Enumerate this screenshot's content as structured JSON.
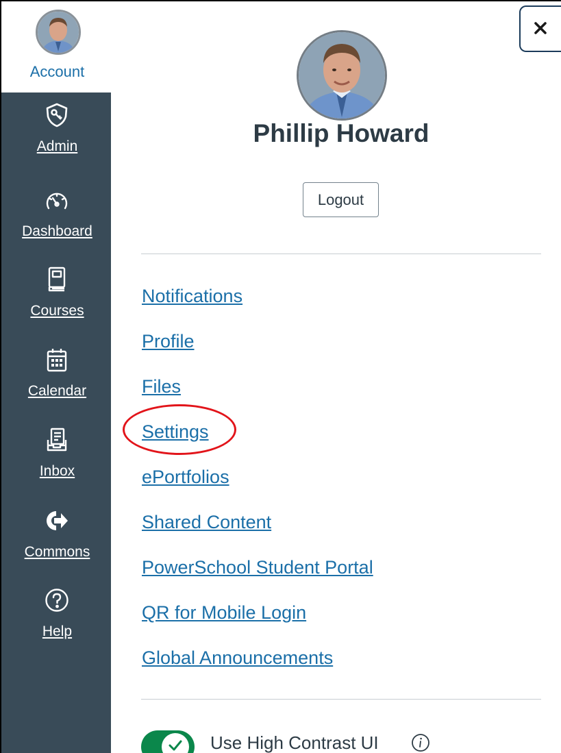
{
  "nav": {
    "account": {
      "label": "Account",
      "icon": "user-avatar"
    },
    "items": [
      {
        "label": "Admin",
        "icon": "shield-icon"
      },
      {
        "label": "Dashboard",
        "icon": "speedometer-icon"
      },
      {
        "label": "Courses",
        "icon": "book-icon"
      },
      {
        "label": "Calendar",
        "icon": "calendar-icon"
      },
      {
        "label": "Inbox",
        "icon": "inbox-icon"
      },
      {
        "label": "Commons",
        "icon": "share-arrow-icon"
      },
      {
        "label": "Help",
        "icon": "question-circle-icon"
      }
    ]
  },
  "tray": {
    "close_label": "×",
    "user_name": "Phillip Howard",
    "logout_label": "Logout",
    "links": [
      "Notifications",
      "Profile",
      "Files",
      "Settings",
      "ePortfolios",
      "Shared Content",
      "PowerSchool Student Portal",
      "QR for Mobile Login",
      "Global Announcements"
    ],
    "highlighted_link": "Settings",
    "high_contrast": {
      "label": "Use High Contrast UI",
      "enabled": true
    }
  },
  "colors": {
    "nav_bg": "#394b58",
    "link": "#1b6fa8",
    "text": "#2d3b45",
    "toggle_on": "#0b874b",
    "annotation_ring": "#e2141a"
  }
}
